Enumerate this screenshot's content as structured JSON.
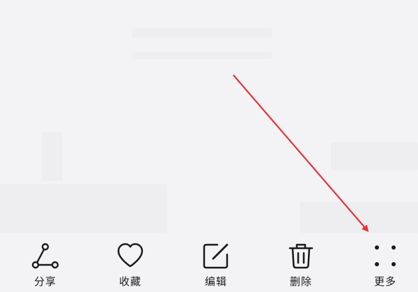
{
  "toolbar": {
    "items": [
      {
        "label": "分享",
        "icon": "share-icon"
      },
      {
        "label": "收藏",
        "icon": "heart-icon"
      },
      {
        "label": "编辑",
        "icon": "edit-icon"
      },
      {
        "label": "删除",
        "icon": "trash-icon"
      },
      {
        "label": "更多",
        "icon": "more-dots-icon"
      }
    ]
  },
  "colors": {
    "background": "#f3f3f5",
    "icon": "#1a1a1a",
    "annotation_arrow": "#e8323a"
  }
}
